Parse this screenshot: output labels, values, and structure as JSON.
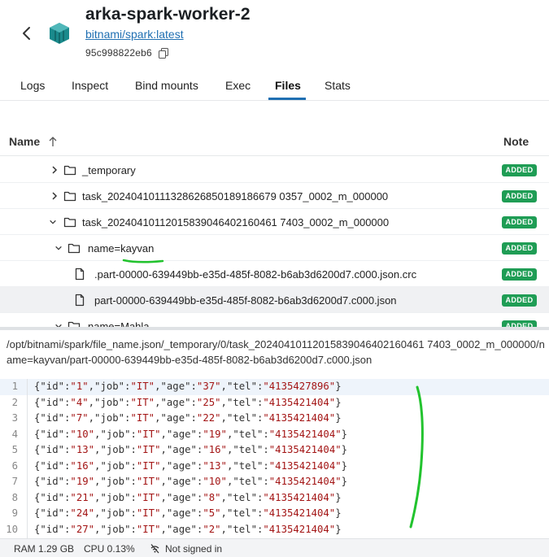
{
  "header": {
    "title": "arka-spark-worker-2",
    "image": "bitnami/spark:latest",
    "container_id": "95c998822eb6"
  },
  "tabs": [
    {
      "label": "Logs",
      "active": false
    },
    {
      "label": "Inspect",
      "active": false
    },
    {
      "label": "Bind mounts",
      "active": false
    },
    {
      "label": "Exec",
      "active": false
    },
    {
      "label": "Files",
      "active": true
    },
    {
      "label": "Stats",
      "active": false
    }
  ],
  "tree": {
    "col_name": "Name",
    "col_note": "Note",
    "rows": [
      {
        "label": "_temporary",
        "type": "folder",
        "expanded": false,
        "badge": "ADDED"
      },
      {
        "label": "task_20240410111328626850189186679 0357_0002_m_000000",
        "type": "folder",
        "expanded": false,
        "badge": "ADDED"
      },
      {
        "label": "task_20240410112015839046402160461 7403_0002_m_000000",
        "type": "folder",
        "expanded": true,
        "badge": "ADDED"
      },
      {
        "label": "name=kayvan",
        "type": "folder",
        "expanded": true,
        "badge": "ADDED"
      },
      {
        "label": ".part-00000-639449bb-e35d-485f-8082-b6ab3d6200d7.c000.json.crc",
        "type": "file",
        "badge": "ADDED"
      },
      {
        "label": "part-00000-639449bb-e35d-485f-8082-b6ab3d6200d7.c000.json",
        "type": "file",
        "selected": true,
        "badge": "ADDED"
      },
      {
        "label": "name=Mahla",
        "type": "folder",
        "expanded": true,
        "badge": "ADDED"
      }
    ]
  },
  "path": "/opt/bitnami/spark/file_name.json/_temporary/0/task_20240410112015839046402160461 7403_0002_m_000000/name=kayvan/part-00000-639449bb-e35d-485f-8082-b6ab3d6200d7.c000.json",
  "code_lines": [
    {
      "n": "1",
      "id": "1",
      "job": "IT",
      "age": "37",
      "tel": "4135427896"
    },
    {
      "n": "2",
      "id": "4",
      "job": "IT",
      "age": "25",
      "tel": "4135421404"
    },
    {
      "n": "3",
      "id": "7",
      "job": "IT",
      "age": "22",
      "tel": "4135421404"
    },
    {
      "n": "4",
      "id": "10",
      "job": "IT",
      "age": "19",
      "tel": "4135421404"
    },
    {
      "n": "5",
      "id": "13",
      "job": "IT",
      "age": "16",
      "tel": "4135421404"
    },
    {
      "n": "6",
      "id": "16",
      "job": "IT",
      "age": "13",
      "tel": "4135421404"
    },
    {
      "n": "7",
      "id": "19",
      "job": "IT",
      "age": "10",
      "tel": "4135421404"
    },
    {
      "n": "8",
      "id": "21",
      "job": "IT",
      "age": "8",
      "tel": "4135421404"
    },
    {
      "n": "9",
      "id": "24",
      "job": "IT",
      "age": "5",
      "tel": "4135421404"
    },
    {
      "n": "10",
      "id": "27",
      "job": "IT",
      "age": "2",
      "tel": "4135421404"
    }
  ],
  "status": {
    "ram": "RAM 1.29 GB",
    "cpu": "CPU 0.13%",
    "signin": "Not signed in"
  },
  "colors": {
    "accent": "#1f6fb2",
    "badge": "#1f9d55",
    "annotation": "#22c32e"
  }
}
